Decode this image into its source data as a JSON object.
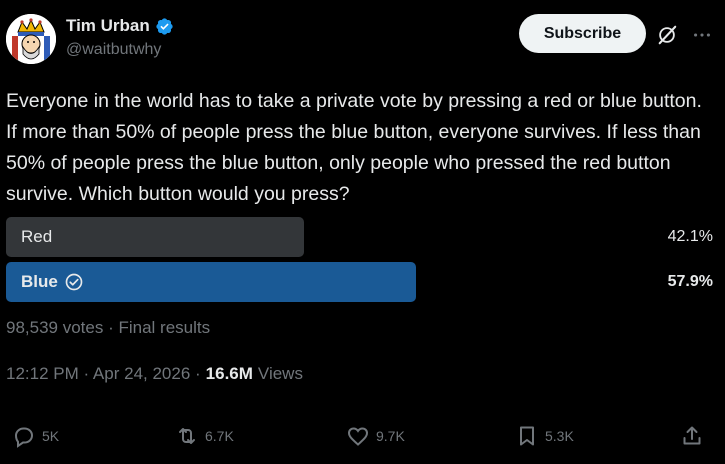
{
  "author": {
    "display_name": "Tim Urban",
    "handle": "@waitbutwhy",
    "verified": true
  },
  "header": {
    "subscribe_label": "Subscribe"
  },
  "tweet": {
    "text": "Everyone in the world has to take a private vote by pressing a red or blue button. If more than 50% of people press the blue button, everyone survives. If less than 50% of people press the blue button, only people who pressed the red button survive. Which button would you press?"
  },
  "poll": {
    "options": [
      {
        "label": "Red",
        "percent_text": "42.1%",
        "percent": 42.1,
        "winner": false
      },
      {
        "label": "Blue",
        "percent_text": "57.9%",
        "percent": 57.9,
        "winner": true
      }
    ],
    "summary": "98,539 votes · Final results"
  },
  "meta": {
    "time": "12:12 PM · Apr 24, 2026 ·",
    "views_count": "16.6M",
    "views_label": "Views"
  },
  "actions": {
    "replies": "5K",
    "reposts": "6.7K",
    "likes": "9.7K",
    "bookmarks": "5.3K"
  },
  "colors": {
    "background": "#000000",
    "text": "#e7e9ea",
    "muted": "#71767b",
    "verified": "#1d9bf0",
    "red_bar": "#333639",
    "blue_bar": "#1a5a96"
  },
  "icons": [
    "verified-badge-icon",
    "grok-icon",
    "more-icon",
    "check-circle-icon",
    "reply-icon",
    "repost-icon",
    "like-icon",
    "bookmark-icon",
    "share-icon"
  ]
}
